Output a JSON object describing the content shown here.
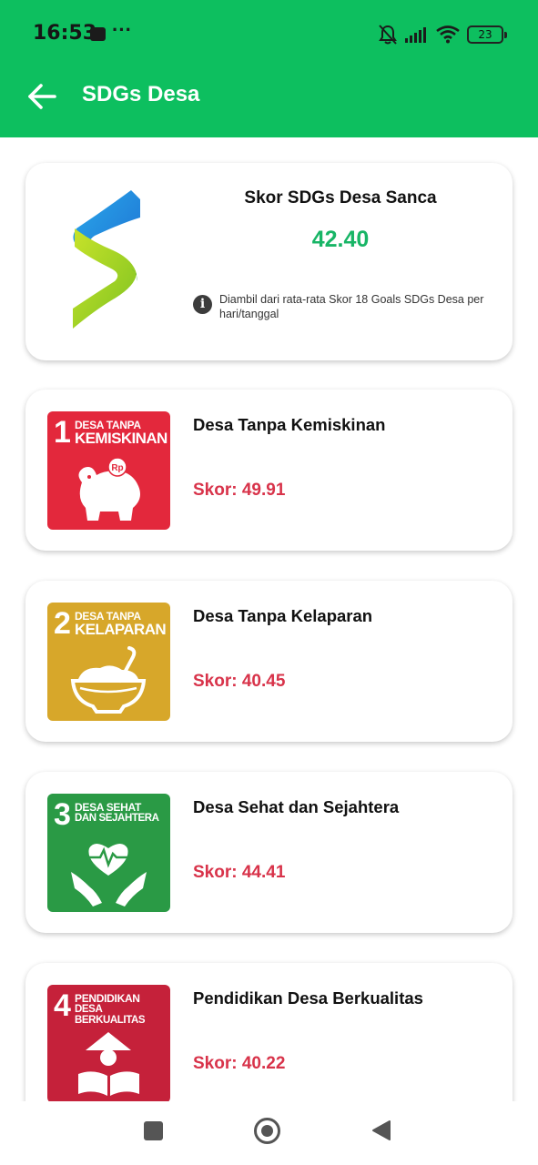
{
  "status_bar": {
    "time": "16:53",
    "dots": "···",
    "battery": "23",
    "icons": [
      "bag-icon",
      "notifications-off-icon",
      "signal-icon",
      "wifi-icon",
      "battery-icon"
    ]
  },
  "app_bar": {
    "title": "SDGs Desa",
    "back_icon": "arrow-left-icon",
    "background_color": "#0dbf5f"
  },
  "summary": {
    "title": "Skor SDGs Desa Sanca",
    "score": "42.40",
    "score_color": "#18b566",
    "info_icon_glyph": "i",
    "note": "Diambil dari rata-rata Skor 18 Goals SDGs Desa per hari/tanggal"
  },
  "goals": [
    {
      "number": "1",
      "icon_line1": "DESA TANPA",
      "icon_line2": "KEMISKINAN",
      "icon_badge": "Rp",
      "icon_color": "#e3283c",
      "title": "Desa Tanpa Kemiskinan",
      "score": "Skor: 49.91"
    },
    {
      "number": "2",
      "icon_line1": "DESA TANPA",
      "icon_line2": "KELAPARAN",
      "icon_color": "#d7a72a",
      "title": "Desa Tanpa Kelaparan",
      "score": "Skor: 40.45"
    },
    {
      "number": "3",
      "icon_line1": "DESA SEHAT",
      "icon_line2": "DAN SEJAHTERA",
      "icon_color": "#2a9a45",
      "title": "Desa Sehat dan Sejahtera",
      "score": "Skor: 44.41"
    },
    {
      "number": "4",
      "icon_line1": "PENDIDIKAN",
      "icon_line2": "DESA BERKUALITAS",
      "icon_color": "#c5213a",
      "title": "Pendidikan Desa Berkualitas",
      "score": "Skor: 40.22"
    }
  ],
  "score_color": "#d8334a",
  "nav_bar": {
    "icons": [
      "recent-apps-icon",
      "home-icon",
      "back-triangle-icon"
    ]
  }
}
